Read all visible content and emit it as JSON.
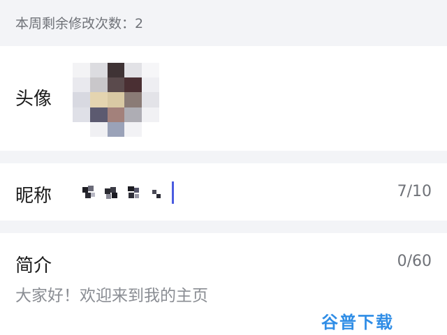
{
  "notice": {
    "text": "本周剩余修改次数：2"
  },
  "avatar_row": {
    "label": "头像"
  },
  "nickname_row": {
    "label": "昵称",
    "counter": "7/10"
  },
  "bio_row": {
    "label": "简介",
    "counter": "0/60",
    "placeholder": "大家好！欢迎来到我的主页"
  },
  "watermark": {
    "text": "谷普下载"
  },
  "colors": {
    "caret": "#4a5be0",
    "watermark": "#2f8de6",
    "muted_text": "#6f7278"
  }
}
